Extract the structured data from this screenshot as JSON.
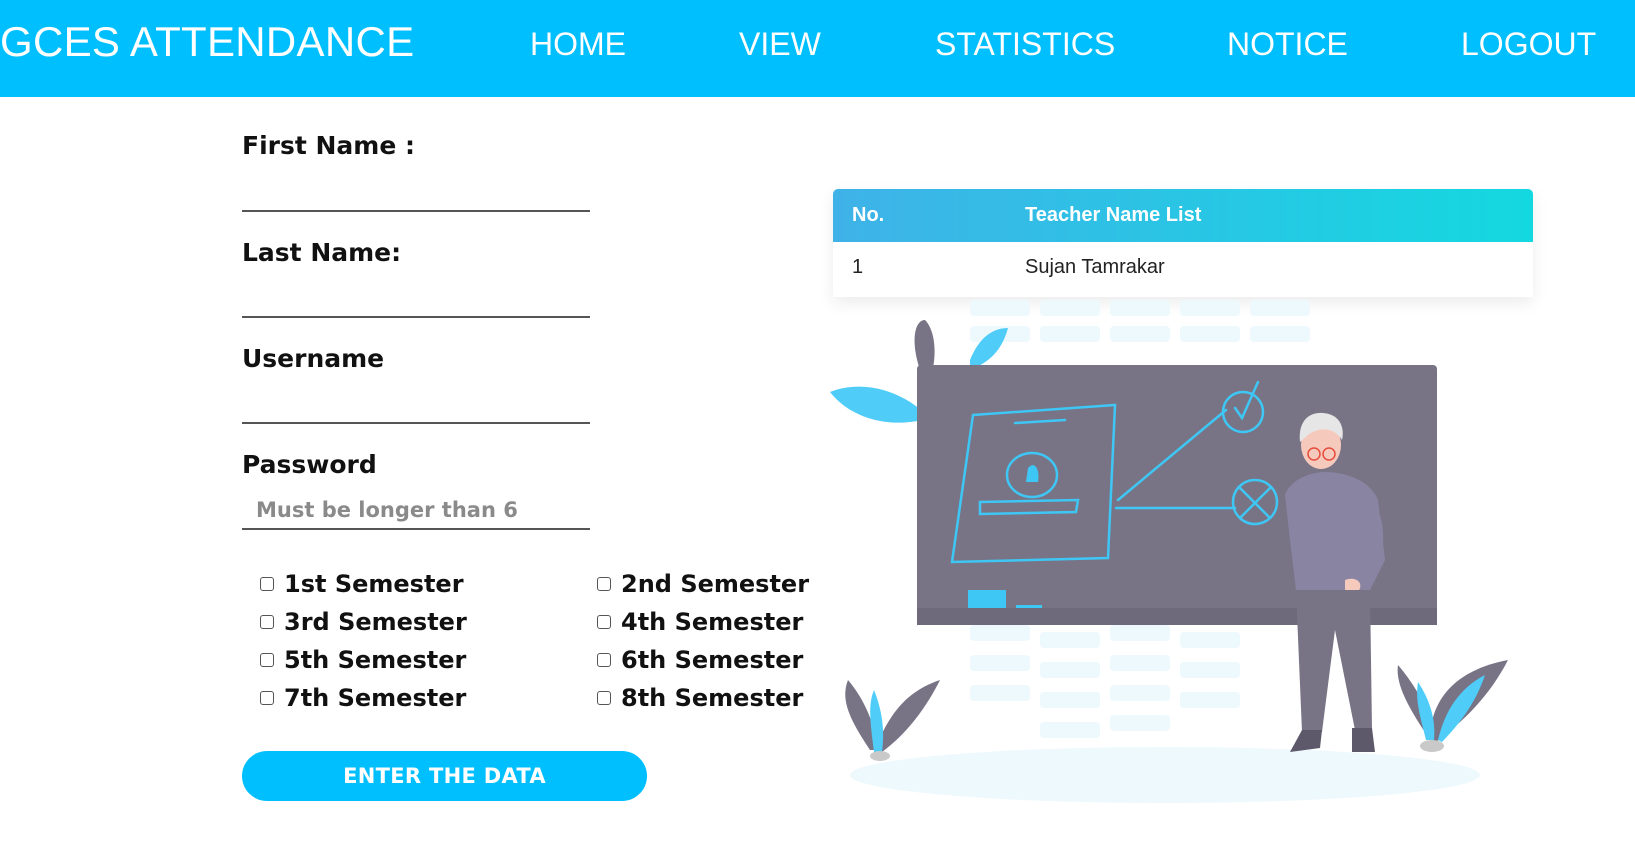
{
  "header": {
    "brand": "GCES ATTENDANCE",
    "nav": [
      "HOME",
      "VIEW",
      "STATISTICS",
      "NOTICE",
      "LOGOUT"
    ],
    "background_color": "#00bfff"
  },
  "form": {
    "first_name_label": "First Name :",
    "first_name_value": "",
    "last_name_label": "Last Name:",
    "last_name_value": "",
    "username_label": "Username",
    "username_value": "",
    "password_label": "Password",
    "password_placeholder": "Must be longer than 6",
    "semesters": [
      {
        "label": "1st Semester",
        "checked": false
      },
      {
        "label": "2nd Semester",
        "checked": false
      },
      {
        "label": "3rd Semester",
        "checked": false
      },
      {
        "label": "4th Semester",
        "checked": false
      },
      {
        "label": "5th Semester",
        "checked": false
      },
      {
        "label": "6th Semester",
        "checked": false
      },
      {
        "label": "7th Semester",
        "checked": false
      },
      {
        "label": "8th Semester",
        "checked": false
      }
    ],
    "submit_label": "ENTER THE DATA"
  },
  "teacher_table": {
    "headers": [
      "No.",
      "Teacher Name List"
    ],
    "rows": [
      [
        "1",
        "Sujan Tamrakar"
      ]
    ]
  },
  "colors": {
    "accent": "#00bfff",
    "illustration_board": "#787486",
    "illustration_line": "#3ec7f5"
  }
}
